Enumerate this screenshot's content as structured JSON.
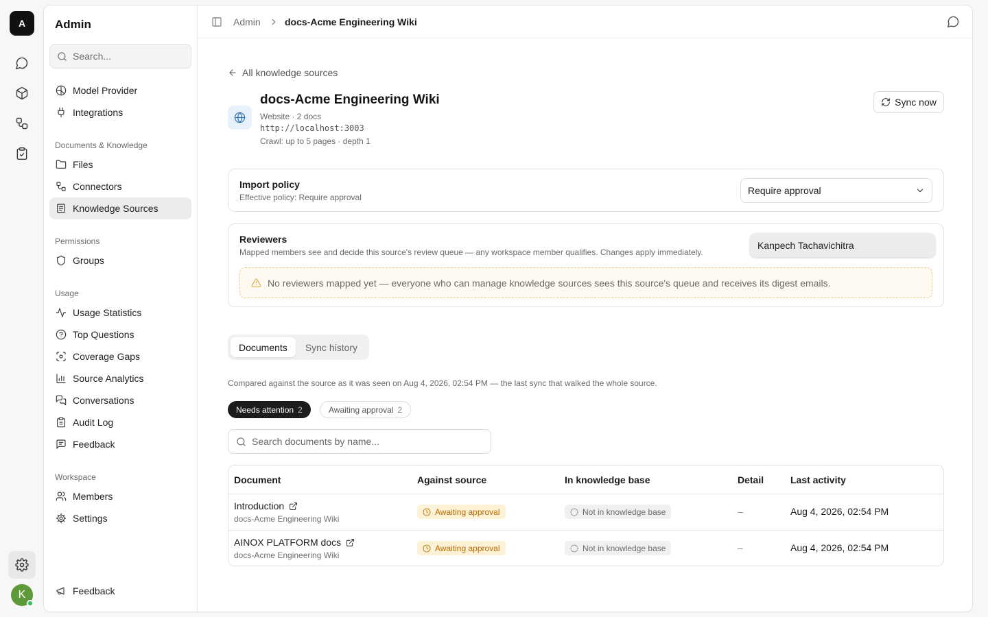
{
  "rail": {
    "workspace_initial": "A",
    "user_initial": "K"
  },
  "sidebar": {
    "title": "Admin",
    "search_placeholder": "Search...",
    "items_top": [
      {
        "label": "Model Provider",
        "icon": "model-provider-icon"
      },
      {
        "label": "Integrations",
        "icon": "plug-icon"
      }
    ],
    "sections": [
      {
        "label": "Documents & Knowledge",
        "items": [
          {
            "label": "Files",
            "icon": "folder-icon"
          },
          {
            "label": "Connectors",
            "icon": "connectors-icon"
          },
          {
            "label": "Knowledge Sources",
            "icon": "knowledge-sources-icon"
          }
        ]
      },
      {
        "label": "Permissions",
        "items": [
          {
            "label": "Groups",
            "icon": "shield-icon"
          }
        ]
      },
      {
        "label": "Usage",
        "items": [
          {
            "label": "Usage Statistics",
            "icon": "activity-icon"
          },
          {
            "label": "Top Questions",
            "icon": "question-icon"
          },
          {
            "label": "Coverage Gaps",
            "icon": "scan-icon"
          },
          {
            "label": "Source Analytics",
            "icon": "bar-chart-icon"
          },
          {
            "label": "Conversations",
            "icon": "conversations-icon"
          },
          {
            "label": "Audit Log",
            "icon": "clipboard-icon"
          },
          {
            "label": "Feedback",
            "icon": "message-square-icon"
          }
        ]
      },
      {
        "label": "Workspace",
        "items": [
          {
            "label": "Members",
            "icon": "users-icon"
          },
          {
            "label": "Settings",
            "icon": "gear-icon"
          }
        ]
      }
    ],
    "footer_feedback": "Feedback"
  },
  "breadcrumb": {
    "parent": "Admin",
    "current": "docs-Acme Engineering Wiki"
  },
  "source": {
    "back_label": "All knowledge sources",
    "title": "docs-Acme Engineering Wiki",
    "meta": "Website · 2 docs",
    "url": "http://localhost:3003",
    "crawl": "Crawl: up to 5 pages · depth 1",
    "sync_label": "Sync now"
  },
  "import_policy": {
    "title": "Import policy",
    "subtitle": "Effective policy: Require approval",
    "selected": "Require approval"
  },
  "reviewers": {
    "title": "Reviewers",
    "subtitle": "Mapped members see and decide this source's review queue — any workspace member qualifies. Changes apply immediately.",
    "suggestion": "Kanpech Tachavichitra",
    "warning": "No reviewers mapped yet — everyone who can manage knowledge sources sees this source's queue and receives its digest emails."
  },
  "tabs": {
    "documents": "Documents",
    "sync_history": "Sync history"
  },
  "compare_note": "Compared against the source as it was seen on Aug 4, 2026, 02:54 PM — the last sync that walked the whole source.",
  "filters": {
    "needs_attention": {
      "label": "Needs attention",
      "count": "2"
    },
    "awaiting_approval": {
      "label": "Awaiting approval",
      "count": "2"
    }
  },
  "doc_search_placeholder": "Search documents by name...",
  "table": {
    "headers": {
      "document": "Document",
      "against_source": "Against source",
      "in_kb": "In knowledge base",
      "detail": "Detail",
      "last_activity": "Last activity"
    },
    "rows": [
      {
        "name": "Introduction",
        "source": "docs-Acme Engineering Wiki",
        "status": "Awaiting approval",
        "kb": "Not in knowledge base",
        "detail": "–",
        "last_activity": "Aug 4, 2026, 02:54 PM"
      },
      {
        "name": "AINOX PLATFORM docs",
        "source": "docs-Acme Engineering Wiki",
        "status": "Awaiting approval",
        "kb": "Not in knowledge base",
        "detail": "–",
        "last_activity": "Aug 4, 2026, 02:54 PM"
      }
    ]
  }
}
